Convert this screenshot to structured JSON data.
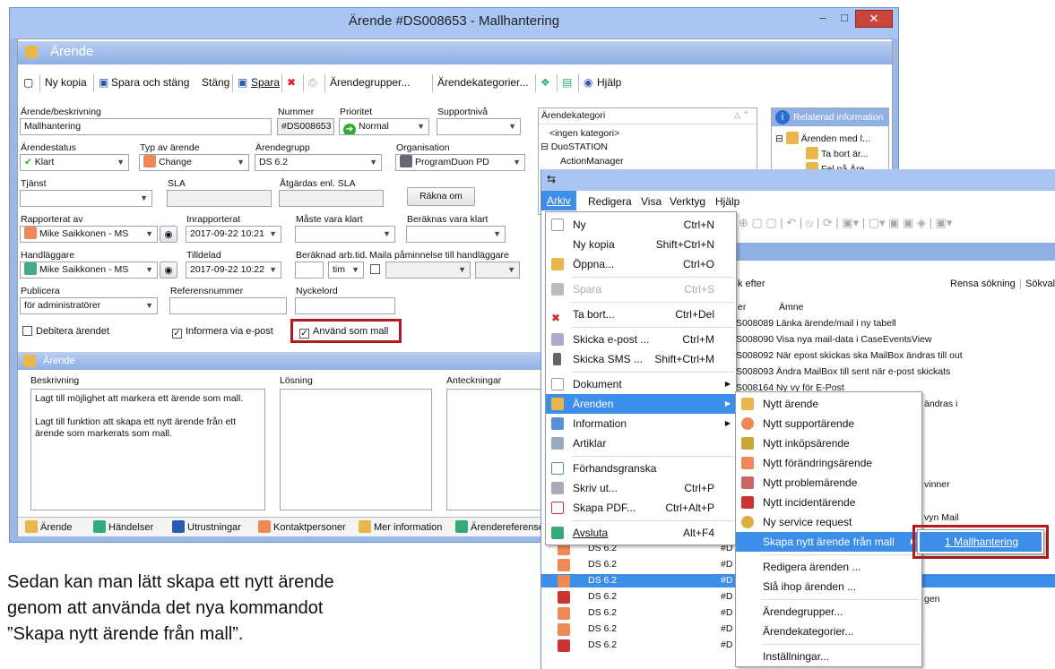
{
  "main_window": {
    "title": "Ärende #DS008653 - Mallhantering",
    "header": "Ärende",
    "toolbar": [
      "Ny kopia",
      "Spara och stäng",
      "Stäng",
      "Spara",
      "Ärendegrupper...",
      "Ärendekategorier...",
      "Hjälp"
    ],
    "form": {
      "beskrivning_label": "Ärende/beskrivning",
      "beskrivning_value": "Mallhantering",
      "nummer_label": "Nummer",
      "nummer_value": "#DS008653",
      "prioritet_label": "Prioritet",
      "prioritet_value": "Normal",
      "supportniva_label": "Supportnivå",
      "status_label": "Ärendestatus",
      "status_value": "Klart",
      "typ_label": "Typ av ärende",
      "typ_value": "Change",
      "grupp_label": "Ärendegrupp",
      "grupp_value": "DS 6.2",
      "org_label": "Organisation",
      "org_value": "ProgramDuon PD",
      "tjanst_label": "Tjänst",
      "sla_label": "SLA",
      "atgardas_label": "Åtgärdas enl. SLA",
      "rakna_button": "Räkna om",
      "rapporterat_label": "Rapporterat av",
      "rapporterat_value": "Mike Saikkonen - MS",
      "inrapporterat_label": "Inrapporterat",
      "inrapporterat_value": "2017-09-22 10:21",
      "maste_label": "Måste vara klart",
      "beraknas_label": "Beräknas vara klart",
      "handlaggare_label": "Handläggare",
      "handlaggare_value": "Mike Saikkonen - MS",
      "tilldelad_label": "Tilldelad",
      "tilldelad_value": "2017-09-22 10:22",
      "arbtid_label": "Beräknad arb.tid.",
      "arbtid_unit": "tim",
      "maila_label": "Maila påminnelse till handläggare",
      "publicera_label": "Publicera",
      "publicera_value": "för administratörer",
      "referens_label": "Referensnummer",
      "nyckelord_label": "Nyckelord",
      "debitera_label": "Debitera ärendet",
      "informera_label": "Informera via e-post",
      "mall_label": "Använd som mall"
    },
    "category_panel": {
      "header": "Ärendekategori",
      "items": [
        "<ingen kategori>",
        "DuoSTATION",
        "ActionManager"
      ]
    },
    "related": {
      "header": "Relaterad information",
      "items": [
        "Ärenden med l...",
        "Ta bort är...",
        "Fel på Äre..."
      ]
    },
    "section2_header": "Ärende",
    "beskrivning_box": {
      "label": "Beskrivning",
      "text": "Lagt till möjlighet att markera ett ärende som mall.\n\nLagt till funktion att skapa ett nytt ärende från ett ärende som markerats som mall."
    },
    "losning_label": "Lösning",
    "anteckningar_label": "Anteckningar",
    "tabs": [
      "Ärende",
      "Händelser",
      "Utrustningar",
      "Kontaktpersoner",
      "Mer information",
      "Ärendereferenser"
    ]
  },
  "list_window": {
    "menubar": [
      "Arkiv",
      "Redigera",
      "Visa",
      "Verktyg",
      "Hjälp"
    ],
    "search_label": "k efter",
    "rensa": "Rensa sökning",
    "sokval": "Sökval",
    "col_nr": "er",
    "col_amne": "Ämne",
    "rows_top": [
      {
        "nr": "S008089",
        "text": "Länka ärende/mail i ny tabell"
      },
      {
        "nr": "S008090",
        "text": "Visa nya mail-data i CaseEventsView"
      },
      {
        "nr": "S008092",
        "text": "När epost skickas ska MailBox ändras till out"
      },
      {
        "nr": "S008093",
        "text": "Ändra MailBox till sent när e-post skickats"
      },
      {
        "nr": "S008164",
        "text": "Ny vy för E-Post"
      }
    ],
    "partial_text": [
      "ändras i",
      "vinner",
      "vyn Mail",
      "gen"
    ],
    "rows_bottom": [
      {
        "group": "DS 6.2",
        "nr": "#D"
      },
      {
        "group": "DS 6.2",
        "nr": "#D"
      },
      {
        "group": "DS 6.2",
        "nr": "#D"
      },
      {
        "group": "DS 6.2",
        "nr": "#D"
      },
      {
        "group": "DS 6.2",
        "nr": "#D"
      },
      {
        "group": "DS 6.2",
        "nr": "#D"
      },
      {
        "group": "DS 6.2",
        "nr": "#D"
      }
    ]
  },
  "arkiv_menu": [
    {
      "label": "Ny",
      "key": "Ctrl+N"
    },
    {
      "label": "Ny kopia",
      "key": "Shift+Ctrl+N"
    },
    {
      "label": "Öppna...",
      "key": "Ctrl+O"
    },
    {
      "label": "Spara",
      "key": "Ctrl+S"
    },
    {
      "label": "Ta bort...",
      "key": "Ctrl+Del"
    },
    {
      "label": "Skicka e-post ...",
      "key": "Ctrl+M"
    },
    {
      "label": "Skicka SMS ...",
      "key": "Shift+Ctrl+M"
    },
    {
      "label": "Dokument",
      "key": ""
    },
    {
      "label": "Ärenden",
      "key": ""
    },
    {
      "label": "Information",
      "key": ""
    },
    {
      "label": "Artiklar",
      "key": ""
    },
    {
      "label": "Förhandsgranska",
      "key": ""
    },
    {
      "label": "Skriv ut...",
      "key": "Ctrl+P"
    },
    {
      "label": "Skapa PDF...",
      "key": "Ctrl+Alt+P"
    },
    {
      "label": "Avsluta",
      "key": "Alt+F4"
    }
  ],
  "arenden_submenu": [
    "Nytt ärende",
    "Nytt supportärende",
    "Nytt inköpsärende",
    "Nytt förändringsärende",
    "Nytt problemärende",
    "Nytt incidentärende",
    "Ny service request",
    "Skapa nytt ärende från mall",
    "Redigera ärenden ...",
    "Slå ihop ärenden ...",
    "Ärendegrupper...",
    "Ärendekategorier...",
    "Inställningar..."
  ],
  "mall_submenu": [
    "1 Mallhantering"
  ],
  "caption": "Sedan kan man lätt skapa ett nytt ärende\ngenom att använda det nya kommandot\n”Skapa nytt ärende från mall”."
}
